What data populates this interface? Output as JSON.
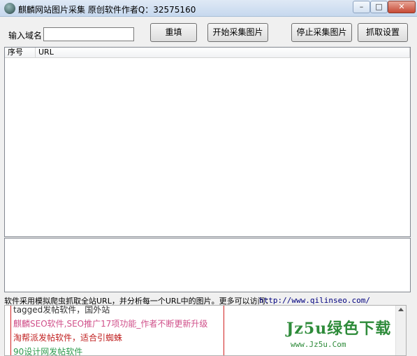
{
  "window": {
    "title": "麒麟网站图片采集 原创软件作者Q：32575160",
    "min_glyph": "–",
    "max_glyph": "□",
    "close_glyph": "✕"
  },
  "toolbar": {
    "domain_label": "输入域名",
    "domain_value": "",
    "reset_label": "重填",
    "start_label": "开始采集图片",
    "stop_label": "停止采集图片",
    "settings_label": "抓取设置"
  },
  "list": {
    "columns": [
      "序号",
      "URL"
    ]
  },
  "info": {
    "text": "软件采用模拟爬虫抓取全站URL，并分析每一个URL中的图片。更多可以访问：",
    "url": "http://www.qilinseo.com/"
  },
  "promo": {
    "items": [
      {
        "text": "tagged发帖软件，国外站",
        "color": "#333333"
      },
      {
        "text": "麒麟SEO软件,SEO推广17项功能_作者不断更新升级",
        "color": "#d0508a"
      },
      {
        "text": "淘帮派发帖软件，适合引蜘蛛",
        "color": "#c02020"
      },
      {
        "text": "90设计网发帖软件",
        "color": "#2e9b4e"
      }
    ]
  },
  "watermark": {
    "main": "Jz5u绿色下载",
    "sub": "www.Jz5u.Com"
  }
}
